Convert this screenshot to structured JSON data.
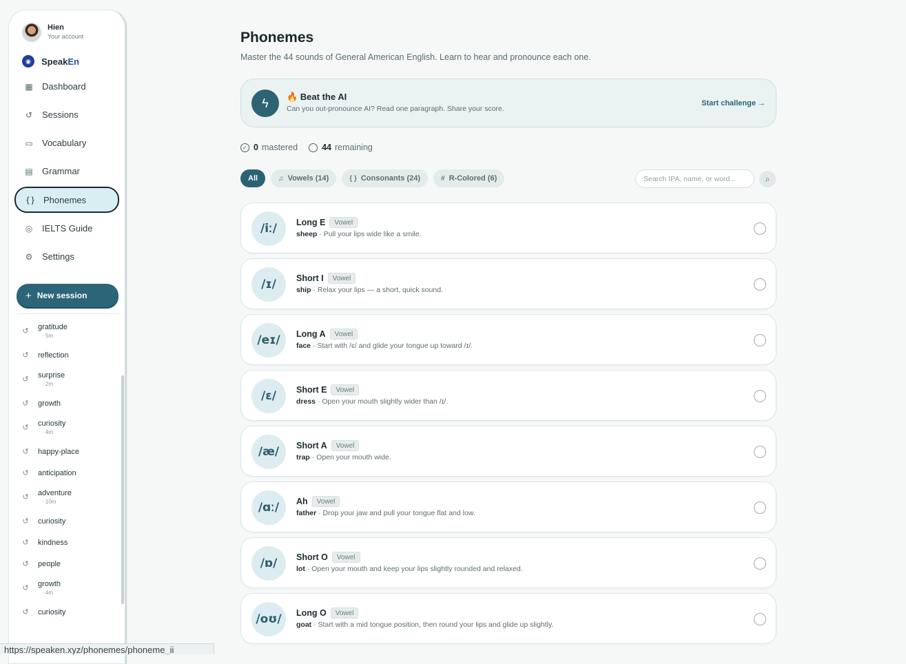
{
  "user": {
    "name": "Hien",
    "subtitle": "Your account"
  },
  "brand": {
    "name_a": "Speak",
    "name_b": "En"
  },
  "nav": [
    {
      "label": "Dashboard",
      "icon": "dashboard-icon"
    },
    {
      "label": "Sessions",
      "icon": "history-icon"
    },
    {
      "label": "Vocabulary",
      "icon": "book-icon"
    },
    {
      "label": "Grammar",
      "icon": "notebook-icon"
    },
    {
      "label": "Phonemes",
      "icon": "braces-icon",
      "active": true
    },
    {
      "label": "IELTS Guide",
      "icon": "target-icon"
    },
    {
      "label": "Settings",
      "icon": "gear-icon"
    }
  ],
  "new_session": "New session",
  "history": [
    {
      "label": "gratitude",
      "meta": "· 5m"
    },
    {
      "label": "reflection",
      "meta": ""
    },
    {
      "label": "surprise",
      "meta": "· 2m"
    },
    {
      "label": "growth",
      "meta": ""
    },
    {
      "label": "curiosity",
      "meta": "· 4m"
    },
    {
      "label": "happy-place",
      "meta": ""
    },
    {
      "label": "anticipation",
      "meta": ""
    },
    {
      "label": "adventure",
      "meta": "· 10m"
    },
    {
      "label": "curiosity",
      "meta": ""
    },
    {
      "label": "kindness",
      "meta": ""
    },
    {
      "label": "people",
      "meta": ""
    },
    {
      "label": "growth",
      "meta": "· 4m"
    },
    {
      "label": "curiosity",
      "meta": ""
    }
  ],
  "page": {
    "title": "Phonemes",
    "subtitle": "Master the 44 sounds of General American English. Learn to hear and pronounce each one."
  },
  "challenge": {
    "title": "🔥 Beat the AI",
    "desc": "Can you out-pronounce AI? Read one paragraph. Share your score.",
    "link": "Start challenge →"
  },
  "progress": {
    "mastered_count": "0",
    "mastered_label": "mastered",
    "remaining_count": "44",
    "remaining_label": "remaining"
  },
  "filters": [
    {
      "label": "All",
      "icon": "",
      "active": true
    },
    {
      "label": "Vowels (14)",
      "icon": "♫"
    },
    {
      "label": "Consonants (24)",
      "icon": "{ }"
    },
    {
      "label": "R-Colored (6)",
      "icon": "#"
    }
  ],
  "search": {
    "placeholder": "Search IPA, name, or word..."
  },
  "phonemes": [
    {
      "ipa": "/iː/",
      "name": "Long E",
      "type": "Vowel",
      "word": "sheep",
      "tip": " · Pull your lips wide like a smile."
    },
    {
      "ipa": "/ɪ/",
      "name": "Short I",
      "type": "Vowel",
      "word": "ship",
      "tip": " · Relax your lips — a short, quick sound."
    },
    {
      "ipa": "/eɪ/",
      "name": "Long A",
      "type": "Vowel",
      "word": "face",
      "tip": " · Start with /ɛ/ and glide your tongue up toward /ɪ/."
    },
    {
      "ipa": "/ɛ/",
      "name": "Short E",
      "type": "Vowel",
      "word": "dress",
      "tip": " · Open your mouth slightly wider than /ɪ/."
    },
    {
      "ipa": "/æ/",
      "name": "Short A",
      "type": "Vowel",
      "word": "trap",
      "tip": " · Open your mouth wide."
    },
    {
      "ipa": "/ɑː/",
      "name": "Ah",
      "type": "Vowel",
      "word": "father",
      "tip": " · Drop your jaw and pull your tongue flat and low."
    },
    {
      "ipa": "/ɒ/",
      "name": "Short O",
      "type": "Vowel",
      "word": "lot",
      "tip": " · Open your mouth and keep your lips slightly rounded and relaxed."
    },
    {
      "ipa": "/oʊ/",
      "name": "Long O",
      "type": "Vowel",
      "word": "goat",
      "tip": " · Start with a mid tongue position, then round your lips and glide up slightly."
    }
  ],
  "status_url": "https://speaken.xyz/phonemes/phoneme_ii",
  "colors": {
    "accent": "#2c6577",
    "active_nav_bg": "#d8eef3",
    "ipa_bg": "#dcecf0"
  }
}
